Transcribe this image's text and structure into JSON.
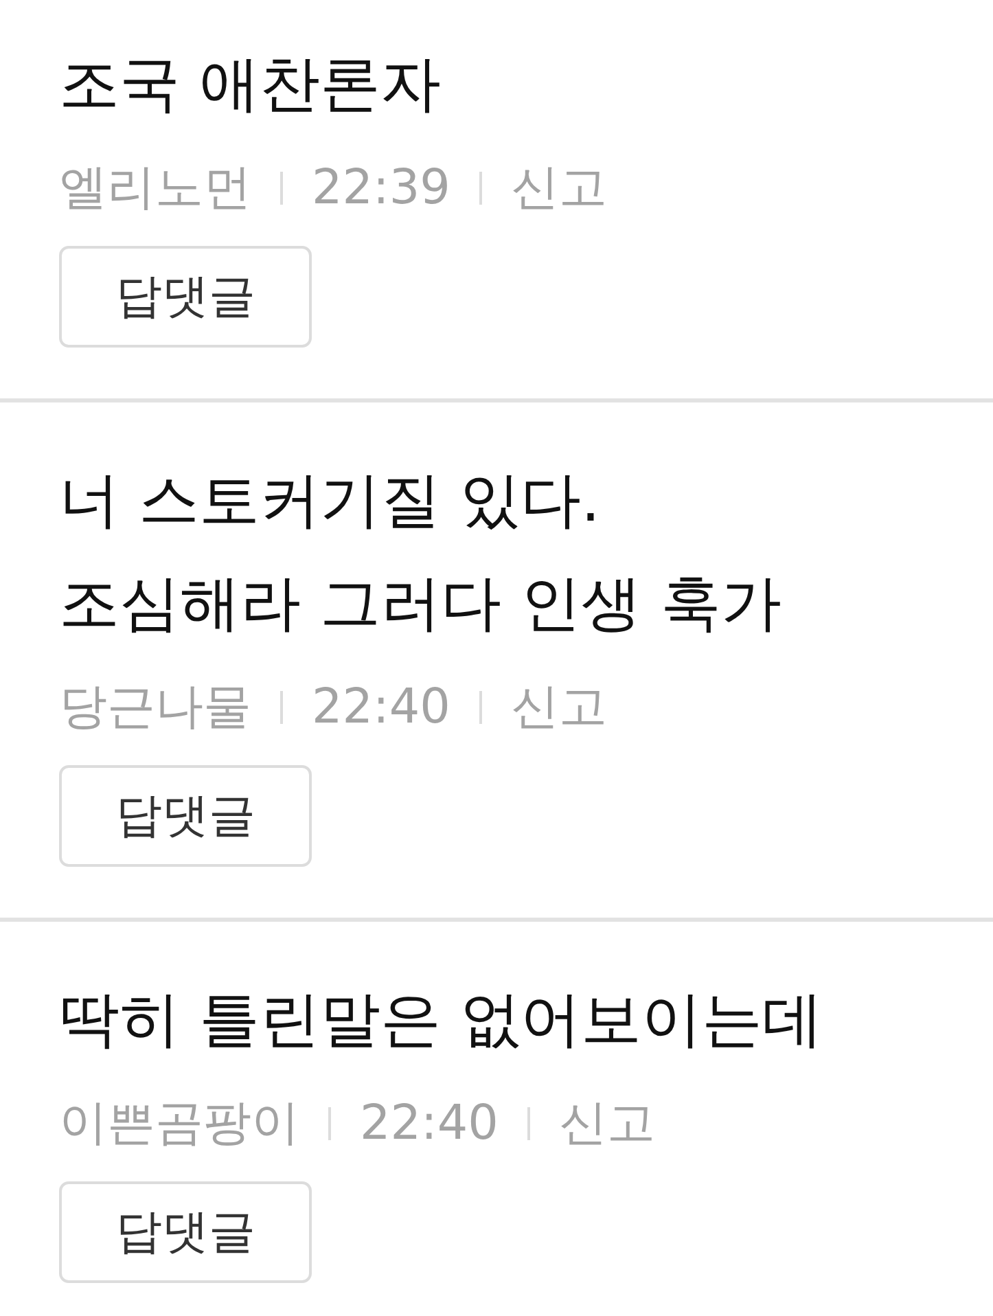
{
  "comments": [
    {
      "lines": [
        "조국 애찬론자"
      ],
      "author": "엘리노먼",
      "time": "22:39",
      "report": "신고",
      "reply_button": "답댓글"
    },
    {
      "lines": [
        "너 스토커기질 있다.",
        "조심해라 그러다 인생 훅가"
      ],
      "author": "당근나물",
      "time": "22:40",
      "report": "신고",
      "reply_button": "답댓글"
    },
    {
      "lines": [
        "딱히 틀린말은 없어보이는데"
      ],
      "author": "이쁜곰팡이",
      "time": "22:40",
      "report": "신고",
      "reply_button": "답댓글"
    }
  ]
}
